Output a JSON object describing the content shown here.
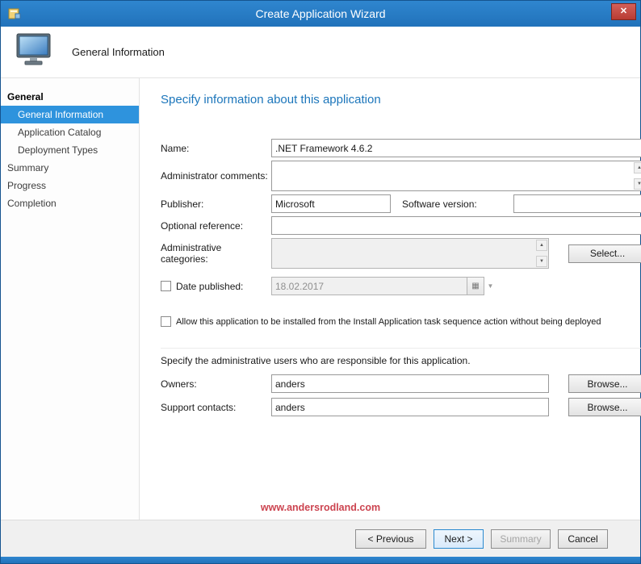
{
  "window": {
    "title": "Create Application Wizard"
  },
  "header": {
    "title": "General Information"
  },
  "sidebar": {
    "items": [
      {
        "label": "General"
      },
      {
        "label": "General Information"
      },
      {
        "label": "Application Catalog"
      },
      {
        "label": "Deployment Types"
      },
      {
        "label": "Summary"
      },
      {
        "label": "Progress"
      },
      {
        "label": "Completion"
      }
    ]
  },
  "content": {
    "heading": "Specify information about this application",
    "fields": {
      "name_label": "Name:",
      "name_value": ".NET Framework 4.6.2",
      "admin_comments_label": "Administrator comments:",
      "admin_comments_value": "",
      "publisher_label": "Publisher:",
      "publisher_value": "Microsoft",
      "software_version_label": "Software version:",
      "software_version_value": "",
      "optional_reference_label": "Optional reference:",
      "optional_reference_value": "",
      "admin_categories_label": "Administrative categories:",
      "admin_categories_value": "",
      "select_button": "Select...",
      "date_published_label": "Date published:",
      "date_published_value": "18.02.2017",
      "allow_checkbox_label": "Allow this application to be installed from the Install Application task sequence action without being deployed",
      "admin_users_text": "Specify the administrative users who are responsible for this application.",
      "owners_label": "Owners:",
      "owners_value": "anders",
      "support_contacts_label": "Support contacts:",
      "support_contacts_value": "anders",
      "owners_browse_button": "Browse...",
      "support_browse_button": "Browse..."
    },
    "watermark": "www.andersrodland.com"
  },
  "footer": {
    "buttons": [
      {
        "label": "< Previous",
        "state": "normal"
      },
      {
        "label": "Next >",
        "state": "default"
      },
      {
        "label": "Summary",
        "state": "disabled"
      },
      {
        "label": "Cancel",
        "state": "normal"
      }
    ]
  },
  "icons": {
    "close": "✕",
    "scroll_up": "▲",
    "scroll_down": "▼",
    "calendar": "▦",
    "dropdown": "▼"
  },
  "colors": {
    "titlebar_blue": "#2779c4",
    "selected_item_blue": "#2e93dd",
    "heading_blue": "#1c76bb",
    "close_red": "#c0453c",
    "watermark_red": "#cc4450"
  }
}
